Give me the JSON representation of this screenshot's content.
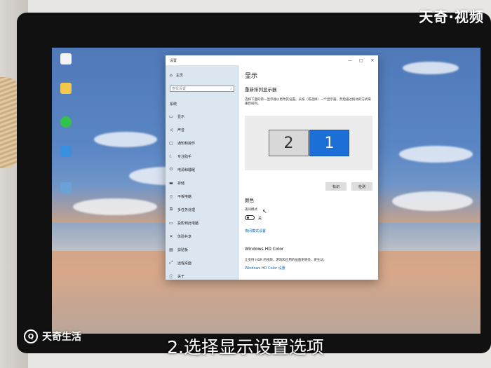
{
  "overlay": {
    "brand_top_right": "天奇·视频",
    "brand_bottom_left": "天奇生活",
    "subtitle": "2.选择显示设置选项"
  },
  "desktop": {
    "icons": [
      {
        "label": "",
        "icon": "file-icon"
      },
      {
        "label": "",
        "icon": "folder-icon"
      },
      {
        "label": "",
        "icon": "wechat-icon"
      },
      {
        "label": "",
        "icon": "computer-icon"
      },
      {
        "label": "",
        "icon": "shortcut-icon"
      }
    ]
  },
  "window": {
    "title": "设置",
    "controls": [
      "—",
      "□",
      "✕"
    ],
    "sidebar": {
      "home": "主页",
      "search_placeholder": "查找设置",
      "section": "系统",
      "items": [
        {
          "label": "显示",
          "icon": "display-icon"
        },
        {
          "label": "声音",
          "icon": "sound-icon"
        },
        {
          "label": "通知和操作",
          "icon": "notification-icon"
        },
        {
          "label": "专注助手",
          "icon": "focus-assist-icon"
        },
        {
          "label": "电源和睡眠",
          "icon": "power-icon"
        },
        {
          "label": "存储",
          "icon": "storage-icon"
        },
        {
          "label": "平板电脑",
          "icon": "tablet-icon"
        },
        {
          "label": "多任务处理",
          "icon": "multitasking-icon"
        },
        {
          "label": "投影到此电脑",
          "icon": "projecting-icon"
        },
        {
          "label": "体验共享",
          "icon": "shared-experiences-icon"
        },
        {
          "label": "剪贴板",
          "icon": "clipboard-icon"
        },
        {
          "label": "远程桌面",
          "icon": "remote-desktop-icon"
        },
        {
          "label": "关于",
          "icon": "about-icon"
        }
      ]
    },
    "content": {
      "heading": "显示",
      "rearrange_heading": "重新排列显示器",
      "rearrange_desc": "选择下面的第一显示器以更改其设置。长按（或选择）一个显示器，然后通过拖动的方式来重新排列。",
      "monitor_2": "2",
      "monitor_1": "1",
      "identify_button": "标识",
      "detect_button": "检测",
      "color_heading": "颜色",
      "night_light_label": "夜间模式",
      "night_light_state": "关",
      "night_light_link": "夜间模式设置",
      "hdr_heading": "Windows HD Color",
      "hdr_desc": "让支持 HDR 的视频、游戏和应用的画面更明亮、更生动。",
      "hdr_link": "Windows HD Color 设置"
    }
  }
}
